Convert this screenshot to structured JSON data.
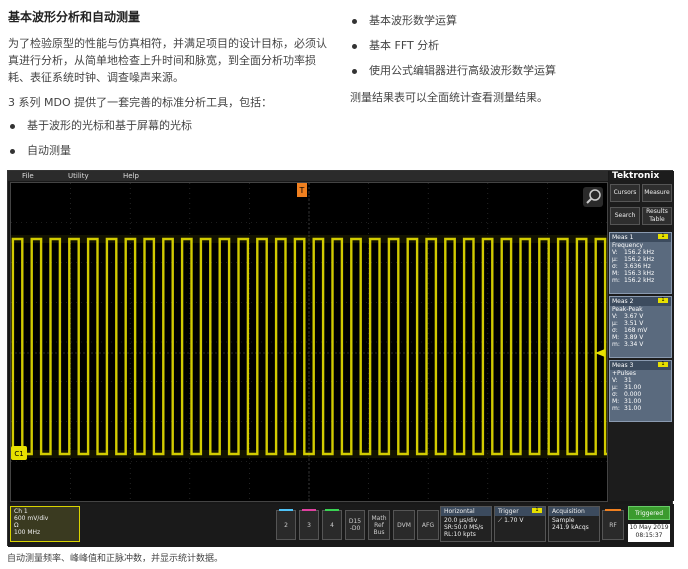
{
  "doc": {
    "title": "基本波形分析和自动测量",
    "para1": "为了检验原型的性能与仿真相符，并满足项目的设计目标，必须认真进行分析，从简单地检查上升时间和脉宽，到全面分析功率损耗、表征系统时钟、调查噪声来源。",
    "para2": "3 系列 MDO 提供了一套完善的标准分析工具，包括：",
    "left_bullets": [
      "基于波形的光标和基于屏幕的光标",
      "自动测量"
    ],
    "right_bullets": [
      "基本波形数学运算",
      "基本 FFT 分析",
      "使用公式编辑器进行高级波形数学运算"
    ],
    "right_text": "测量结果表可以全面统计查看测量结果。",
    "caption": "自动测量频率、峰峰值和正脉冲数，并显示统计数据。"
  },
  "scope": {
    "menu": [
      "File",
      "Utility",
      "Help"
    ],
    "brand": "Tektronix",
    "buttons": [
      "Cursors",
      "Measure",
      "Search",
      "Results Table"
    ],
    "trigger_marker": "T",
    "channel_label": "C1",
    "measurements": [
      {
        "title": "Meas 1",
        "badge": "1",
        "name": "Frequency",
        "rows": [
          [
            "V:",
            "156.2 kHz"
          ],
          [
            "µ:",
            "156.2 kHz"
          ],
          [
            "σ:",
            "3.636 Hz"
          ],
          [
            "M:",
            "156.3 kHz"
          ],
          [
            "m:",
            "156.2 kHz"
          ]
        ]
      },
      {
        "title": "Meas 2",
        "badge": "1",
        "name": "Peak-Peak",
        "rows": [
          [
            "V:",
            "3.67 V"
          ],
          [
            "µ:",
            "3.51 V"
          ],
          [
            "σ:",
            "168 mV"
          ],
          [
            "M:",
            "3.89 V"
          ],
          [
            "m:",
            "3.34 V"
          ]
        ]
      },
      {
        "title": "Meas 3",
        "badge": "1",
        "name": "+Pulses",
        "rows": [
          [
            "V:",
            "31"
          ],
          [
            "µ:",
            "31.00"
          ],
          [
            "σ:",
            "0.000"
          ],
          [
            "M:",
            "31.00"
          ],
          [
            "m:",
            "31.00"
          ]
        ]
      }
    ],
    "ch1": {
      "title": "Ch 1",
      "line1": "600 mV/div",
      "line2": "Ω",
      "line3": "100 MHz"
    },
    "channel_buttons": [
      "2",
      "3",
      "4",
      "D15\n-D0",
      "Math\nRef\nBus",
      "DVM",
      "AFG"
    ],
    "horizontal": {
      "title": "Horizontal",
      "l1": "20.0 µs/div",
      "l2": "SR:50.0 MS/s",
      "l3": "RL:10 kpts"
    },
    "trigger": {
      "title": "Trigger",
      "badge": "1",
      "l1": "1.70 V"
    },
    "acquisition": {
      "title": "Acquisition",
      "l1": "Sample",
      "l2": "241.9 kAcqs"
    },
    "rf": "RF",
    "status": "Triggered",
    "date": "10 May 2019",
    "time": "08:15:37",
    "colors": {
      "ch1": "#e8e000",
      "ch2": "#4fc3f7",
      "ch3": "#e040a0",
      "ch4": "#39d353"
    },
    "waveform": {
      "pulses": 31,
      "frequency_khz": 156.2
    }
  }
}
